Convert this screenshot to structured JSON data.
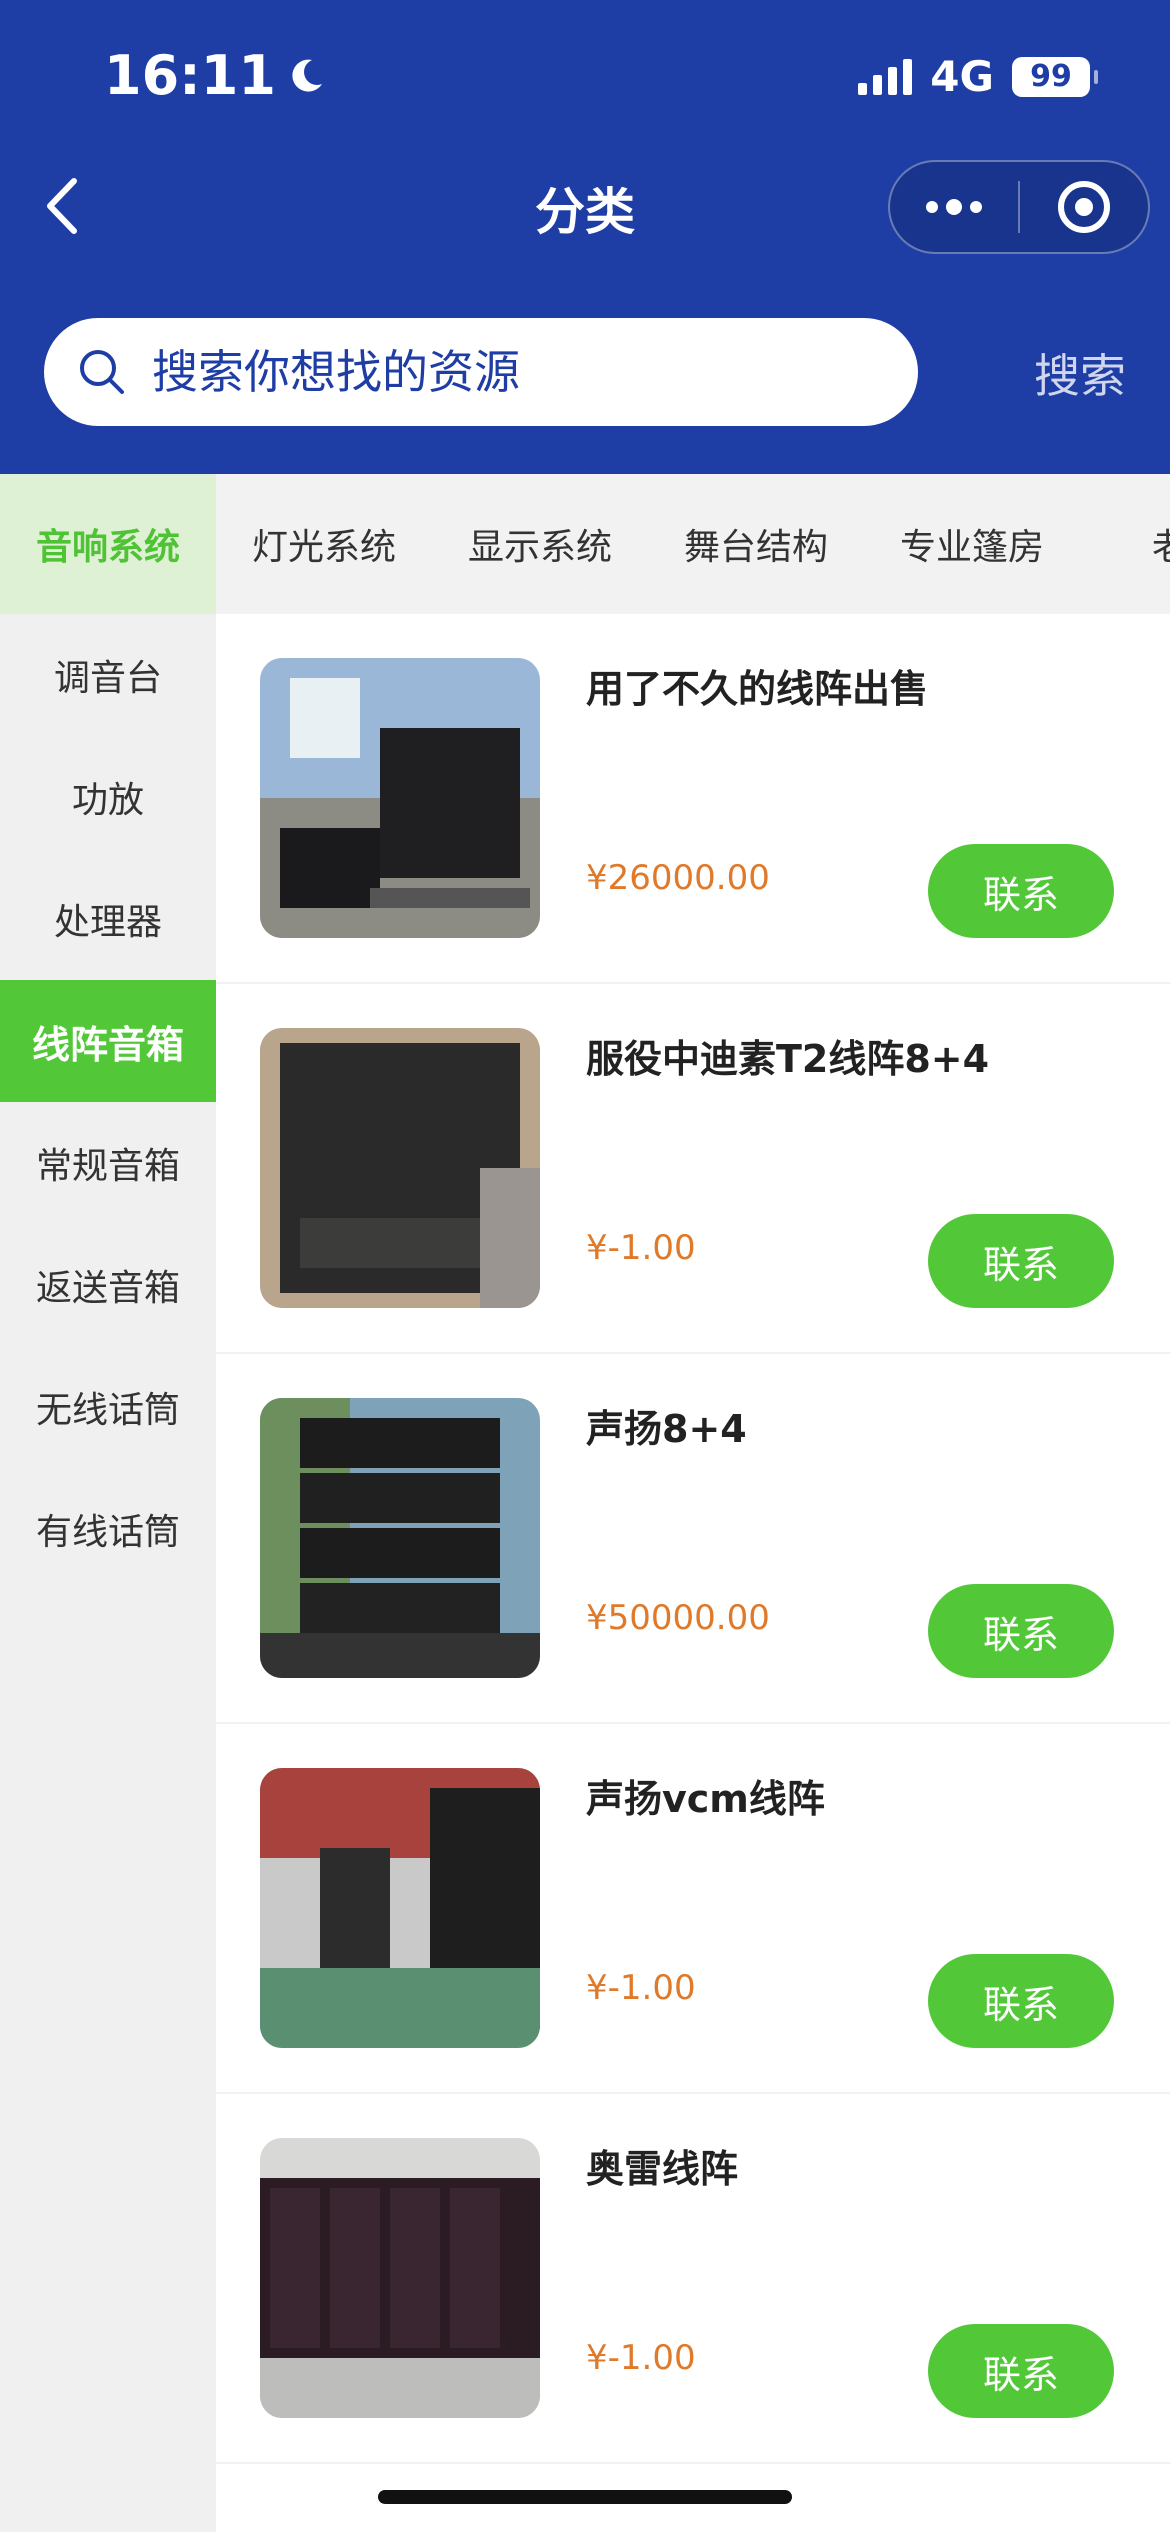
{
  "status": {
    "time": "16:11",
    "network": "4G",
    "battery": "99"
  },
  "nav": {
    "title": "分类"
  },
  "search": {
    "placeholder": "搜索你想找的资源",
    "button": "搜索"
  },
  "tabs": [
    "音响系统",
    "灯光系统",
    "显示系统",
    "舞台结构",
    "专业篷房",
    "老硕"
  ],
  "sidebar": [
    "调音台",
    "功放",
    "处理器",
    "线阵音箱",
    "常规音箱",
    "返送音箱",
    "无线话筒",
    "有线话筒"
  ],
  "products": [
    {
      "title": "用了不久的线阵出售",
      "price": "¥26000.00",
      "action": "联系"
    },
    {
      "title": "服役中迪素T2线阵8+4",
      "price": "¥-1.00",
      "action": "联系"
    },
    {
      "title": "声扬8+4",
      "price": "¥50000.00",
      "action": "联系"
    },
    {
      "title": "声扬vcm线阵",
      "price": "¥-1.00",
      "action": "联系"
    },
    {
      "title": "奥雷线阵",
      "price": "¥-1.00",
      "action": "联系"
    }
  ],
  "colors": {
    "header": "#1e3ea6",
    "accent": "#52c839",
    "price": "#e07a2b"
  },
  "icons": {
    "moon": "moon-icon",
    "back": "chevron-left-icon",
    "more": "more-dots-icon",
    "close": "target-icon",
    "search": "search-icon"
  }
}
